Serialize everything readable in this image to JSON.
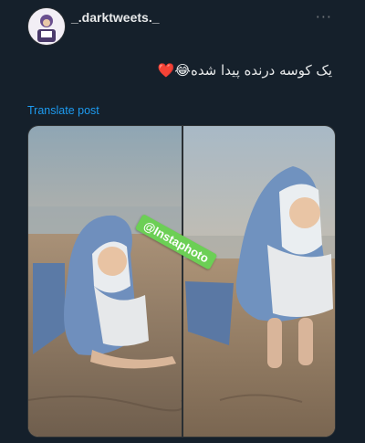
{
  "author": {
    "username": "_.darktweets._",
    "avatar_icon": "cartoon-avatar-icon"
  },
  "more_icon": "more-horizontal-icon",
  "post": {
    "text": "یک کوسه درنده پیدا شده😂❤️",
    "translate_label": "Translate post"
  },
  "media": {
    "watermark": "@Instaphoto"
  },
  "colors": {
    "background": "#15202b",
    "link": "#1d9bf0",
    "watermark_bg": "#6ccf55"
  }
}
